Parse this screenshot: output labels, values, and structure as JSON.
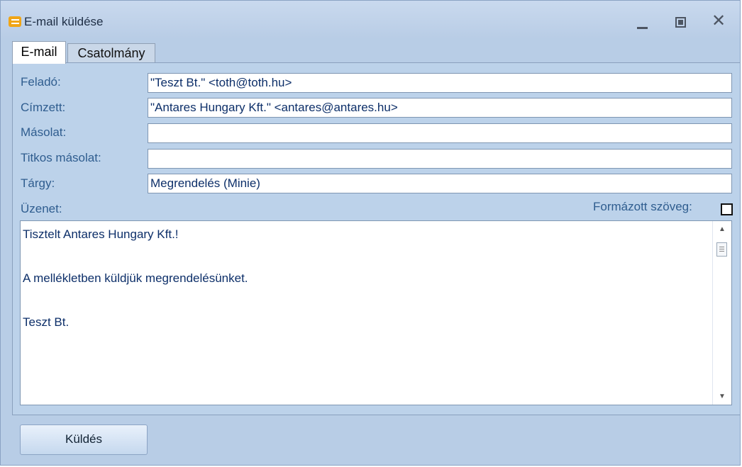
{
  "window": {
    "title": "E-mail küldése"
  },
  "tabs": [
    {
      "label": "E-mail"
    },
    {
      "label": "Csatolmány"
    }
  ],
  "form": {
    "sender": {
      "label": "Feladó:",
      "value": "\"Teszt Bt.\" <toth@toth.hu>"
    },
    "recipient": {
      "label": "Címzett:",
      "value": "\"Antares Hungary Kft.\" <antares@antares.hu>"
    },
    "cc": {
      "label": "Másolat:",
      "value": ""
    },
    "bcc": {
      "label": "Titkos másolat:",
      "value": ""
    },
    "subject": {
      "label": "Tárgy:",
      "value": "Megrendelés (Minie)"
    },
    "message": {
      "label": "Üzenet:",
      "formatted_label": "Formázott szöveg:",
      "formatted_checked": false,
      "lines": [
        "Tisztelt Antares Hungary Kft.!",
        "",
        "A mellékletben küldjük megrendelésünket.",
        "",
        "Teszt Bt."
      ]
    }
  },
  "footer": {
    "send_label": "Küldés"
  }
}
